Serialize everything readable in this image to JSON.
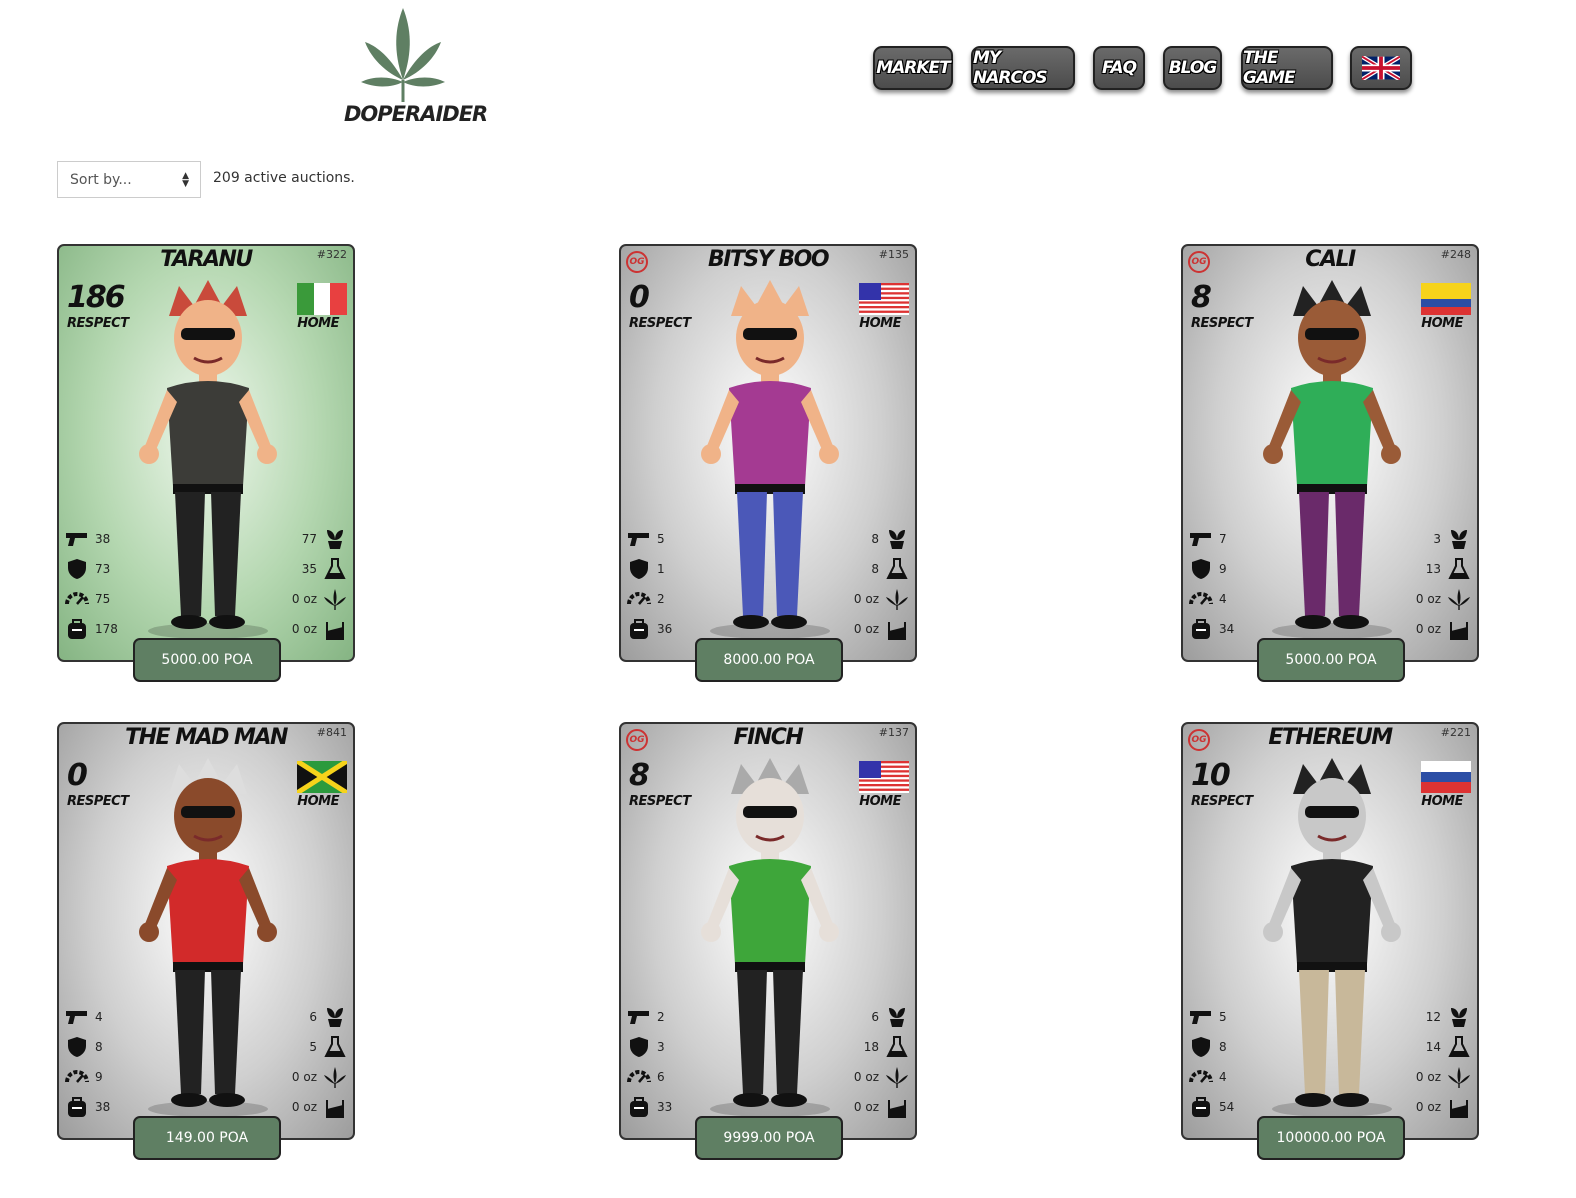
{
  "brand": {
    "name": "DOPERAIDER",
    "color": "#5f7f63"
  },
  "nav": {
    "items": [
      {
        "label": "MARKET"
      },
      {
        "label": "MY NARCOS"
      },
      {
        "label": "FAQ"
      },
      {
        "label": "BLOG"
      },
      {
        "label": "THE GAME"
      }
    ],
    "language_icon": "uk-flag-icon"
  },
  "toolbar": {
    "sort_placeholder": "Sort by...",
    "auction_count": "209 active auctions."
  },
  "card_labels": {
    "respect": "RESPECT",
    "home": "HOME",
    "og": "OG"
  },
  "cards": [
    {
      "name": "TARANU",
      "id": "#322",
      "respect": "186",
      "og": false,
      "flag": "italy",
      "bg": "green",
      "stats": {
        "attack": "38",
        "defense": "73",
        "speed": "75",
        "capacity": "178",
        "plant": "77",
        "chem": "35",
        "weed": "0 oz",
        "coke": "0 oz"
      },
      "price": "5000.00 POA"
    },
    {
      "name": "BITSY BOO",
      "id": "#135",
      "respect": "0",
      "og": true,
      "flag": "usa",
      "bg": "gray",
      "stats": {
        "attack": "5",
        "defense": "1",
        "speed": "2",
        "capacity": "36",
        "plant": "8",
        "chem": "8",
        "weed": "0 oz",
        "coke": "0 oz"
      },
      "price": "8000.00 POA"
    },
    {
      "name": "CALI",
      "id": "#248",
      "respect": "8",
      "og": true,
      "flag": "colombia",
      "bg": "gray",
      "stats": {
        "attack": "7",
        "defense": "9",
        "speed": "4",
        "capacity": "34",
        "plant": "3",
        "chem": "13",
        "weed": "0 oz",
        "coke": "0 oz"
      },
      "price": "5000.00 POA"
    },
    {
      "name": "THE MAD MAN",
      "id": "#841",
      "respect": "0",
      "og": false,
      "flag": "jamaica",
      "bg": "gray",
      "stats": {
        "attack": "4",
        "defense": "8",
        "speed": "9",
        "capacity": "38",
        "plant": "6",
        "chem": "5",
        "weed": "0 oz",
        "coke": "0 oz"
      },
      "price": "149.00 POA"
    },
    {
      "name": "FINCH",
      "id": "#137",
      "respect": "8",
      "og": true,
      "flag": "usa",
      "bg": "gray",
      "stats": {
        "attack": "2",
        "defense": "3",
        "speed": "6",
        "capacity": "33",
        "plant": "6",
        "chem": "18",
        "weed": "0 oz",
        "coke": "0 oz"
      },
      "price": "9999.00 POA"
    },
    {
      "name": "ETHEREUM",
      "id": "#221",
      "respect": "10",
      "og": true,
      "flag": "russia",
      "bg": "gray",
      "stats": {
        "attack": "5",
        "defense": "8",
        "speed": "4",
        "capacity": "54",
        "plant": "12",
        "chem": "14",
        "weed": "0 oz",
        "coke": "0 oz"
      },
      "price": "100000.00 POA"
    }
  ]
}
